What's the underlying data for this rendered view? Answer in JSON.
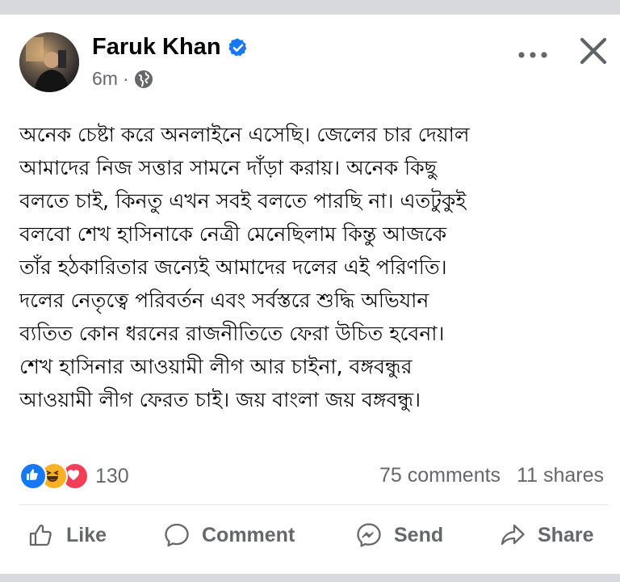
{
  "post": {
    "author": "Faruk Khan",
    "time": "6m",
    "separator": "·",
    "lines": [
      "অনেক চেষ্টা করে অনলাইনে এসেছি। জেলের চার দেয়াল",
      "আমাদের নিজ সত্তার সামনে দাঁড়া করায়। অনেক কিছু",
      "বলতে চাই, কিনতু এখন সবই বলতে পারছি না। এতটুকুই",
      "বলবো শেখ হাসিনাকে নেত্রী মেনেছিলাম কিন্তু আজকে",
      "তাঁর হঠকারিতার জন্যেই আমাদের দলের এই পরিণতি।",
      "দলের নেতৃত্বে পরিবর্তন এবং সর্বস্তরে শুদ্ধি অভিযান",
      "ব্যতিত কোন ধরনের রাজনীতিতে ফেরা উচিত হবেনা।",
      "শেখ হাসিনার আওয়ামী লীগ আর চাইনা, বঙ্গবন্ধুর",
      "আওয়ামী লীগ ফেরত চাই। জয় বাংলা জয় বঙ্গবন্ধু।"
    ]
  },
  "reactions": {
    "icons": [
      "like-icon",
      "haha-icon",
      "love-icon"
    ],
    "count": "130"
  },
  "stats": {
    "comments": "75 comments",
    "shares": "11 shares"
  },
  "actions": {
    "like": "Like",
    "comment": "Comment",
    "send": "Send",
    "share": "Share"
  },
  "colors": {
    "accent": "#1877f2",
    "love": "#f33e58",
    "haha": "#f7b125",
    "muted": "#65676b"
  }
}
